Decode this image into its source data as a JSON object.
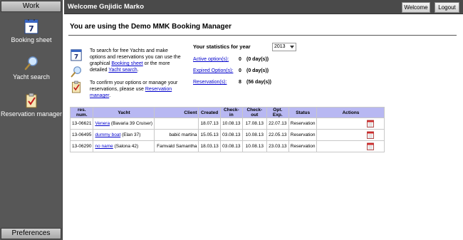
{
  "sidebar": {
    "work_label": "Work",
    "preferences_label": "Preferences",
    "items": [
      {
        "label": "Booking sheet",
        "icon": "calendar-icon"
      },
      {
        "label": "Yacht search",
        "icon": "magnifier-icon"
      },
      {
        "label": "Reservation manager",
        "icon": "clipboard-check-icon"
      }
    ]
  },
  "topbar": {
    "welcome_text": "Welcome Gnjidic Marko",
    "welcome_button": "Welcome",
    "logout_button": "Logout"
  },
  "main": {
    "title": "You are using the Demo MMK Booking Manager",
    "info1": {
      "text_before": "To search for free Yachts and make options and reservations you can use the graphical ",
      "link1": "Booking sheet",
      "text_mid": " or the more detailed ",
      "link2": "Yacht search",
      "text_after": "."
    },
    "info2": {
      "text_before": "To confirm your options or manage your reservations, please use ",
      "link": "Reservation manager",
      "text_after": "."
    },
    "stats": {
      "title": "Your statistics for year",
      "year": "2013",
      "rows": [
        {
          "label": "Active option(s):",
          "count": "0",
          "days": "(0 day(s))"
        },
        {
          "label": "Expired Option(s):",
          "count": "0",
          "days": "(0 day(s))"
        },
        {
          "label": "Reservation(s):",
          "count": "8",
          "days": "(56 day(s))"
        }
      ]
    },
    "table": {
      "headers": [
        "res. num.",
        "Yacht",
        "Client",
        "Created",
        "Check-in",
        "Check-out",
        "Opt. Exp.",
        "Status",
        "Actions"
      ],
      "rows": [
        {
          "res": "13-06621",
          "yacht": "Venera",
          "model": "(Bavaria 39 Cruiser)",
          "client": "",
          "created": "18.07.13",
          "checkin": "10.08.13",
          "checkout": "17.08.13",
          "optexp": "22.07.13",
          "status": "Reservation"
        },
        {
          "res": "13-06495",
          "yacht": "dummy boat",
          "model": "(Elan 37)",
          "client": "babić martina",
          "created": "15.05.13",
          "checkin": "03.08.13",
          "checkout": "10.08.13",
          "optexp": "22.05.13",
          "status": "Reservation"
        },
        {
          "res": "13-06290",
          "yacht": "no name",
          "model": "(Salona 42)",
          "client": "Famvald Samantha",
          "created": "18.03.13",
          "checkin": "03.08.13",
          "checkout": "10.08.13",
          "optexp": "23.03.13",
          "status": "Reservation"
        }
      ]
    }
  }
}
